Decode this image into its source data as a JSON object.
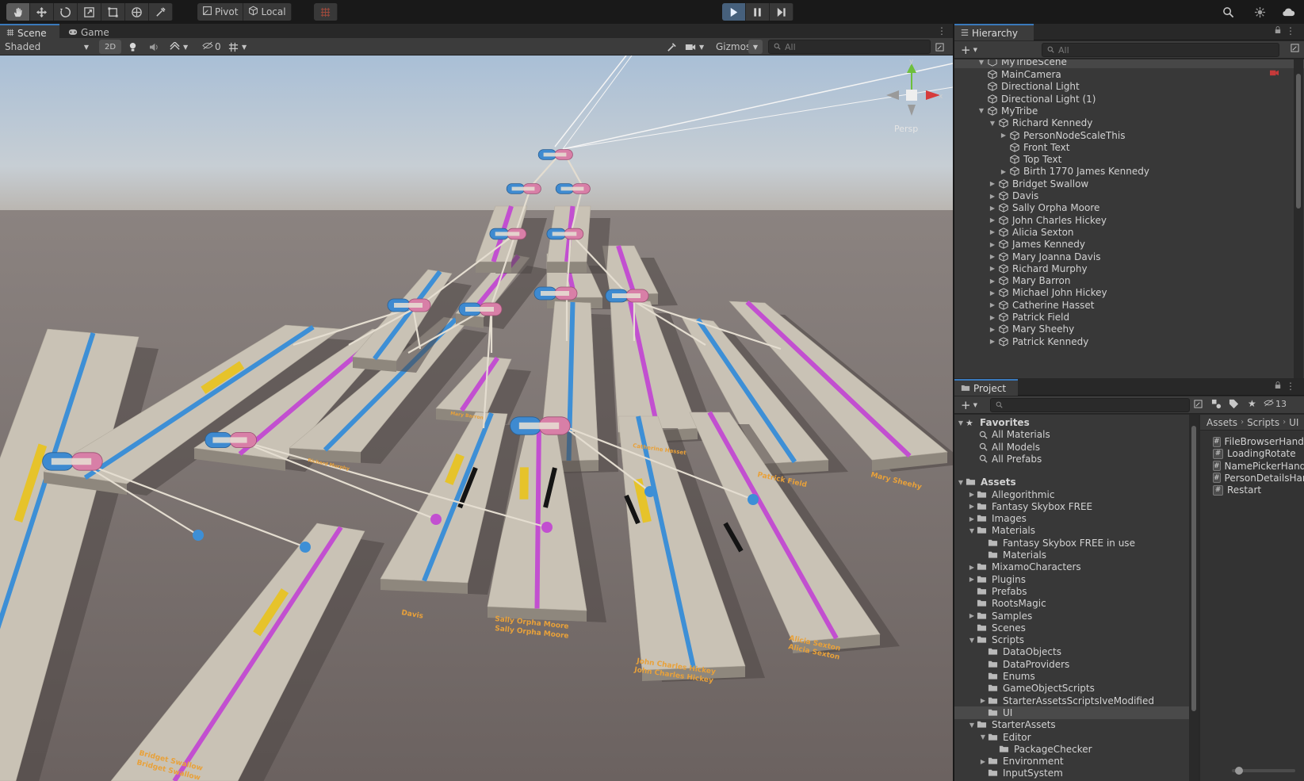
{
  "toolbar": {
    "tools": [
      "hand-tool-icon",
      "move-tool-icon",
      "rotate-tool-icon",
      "scale-tool-icon",
      "rect-tool-icon",
      "transform-tool-icon",
      "custom-tool-icon"
    ],
    "pivot_label": "Pivot",
    "local_label": "Local"
  },
  "scene_view": {
    "tabs": [
      {
        "label": "Scene"
      },
      {
        "label": "Game"
      }
    ],
    "shading_mode": "Shaded",
    "mode_2d": "2D",
    "hidden_count": "0",
    "gizmos_label": "Gizmos",
    "search_placeholder": "All",
    "projection_label": "Persp",
    "gizmo_axis_y": "y",
    "gizmo_axis_x": "x",
    "nodes": [
      {
        "label": "Bridget Swallow",
        "mirrored_label": "Bridget Swallow"
      },
      {
        "label": "Davis",
        "mirrored_label": "Davis"
      },
      {
        "label": "Sally Orpha Moore",
        "mirrored_label": "Sally Orpha Moore"
      },
      {
        "label": "John Charles Hickey",
        "mirrored_label": "John Charles Hickey"
      },
      {
        "label": "Alicia Sexton",
        "mirrored_label": "Alicia Sexton"
      },
      {
        "label": "Patrick Field"
      },
      {
        "label": "Mary Sheehy"
      },
      {
        "label": "Catherine Hasset"
      },
      {
        "label": "Mary Barron"
      },
      {
        "label": "Richard Murphy"
      },
      {
        "label": "Michael John Hickey"
      },
      {
        "label": "Mary Joanna Davis"
      },
      {
        "label": "James Kennedy"
      }
    ]
  },
  "hierarchy": {
    "tab_label": "Hierarchy",
    "search_placeholder": "All",
    "scene_name": "MyTribeScene",
    "rows": [
      {
        "label": "MainCamera",
        "indent": 1,
        "arrow": ""
      },
      {
        "label": "Directional Light",
        "indent": 1,
        "arrow": ""
      },
      {
        "label": "Directional Light (1)",
        "indent": 1,
        "arrow": ""
      },
      {
        "label": "MyTribe",
        "indent": 1,
        "arrow": "▼"
      },
      {
        "label": "Richard Kennedy",
        "indent": 2,
        "arrow": "▼"
      },
      {
        "label": "PersonNodeScaleThis",
        "indent": 3,
        "arrow": "▶"
      },
      {
        "label": "Front Text",
        "indent": 3,
        "arrow": ""
      },
      {
        "label": "Top Text",
        "indent": 3,
        "arrow": ""
      },
      {
        "label": "Birth 1770 James Kennedy",
        "indent": 3,
        "arrow": "▶"
      },
      {
        "label": "Bridget Swallow",
        "indent": 2,
        "arrow": "▶"
      },
      {
        "label": "Davis",
        "indent": 2,
        "arrow": "▶"
      },
      {
        "label": "Sally Orpha Moore",
        "indent": 2,
        "arrow": "▶"
      },
      {
        "label": "John Charles Hickey",
        "indent": 2,
        "arrow": "▶"
      },
      {
        "label": "Alicia Sexton",
        "indent": 2,
        "arrow": "▶"
      },
      {
        "label": "James Kennedy",
        "indent": 2,
        "arrow": "▶"
      },
      {
        "label": "Mary Joanna Davis",
        "indent": 2,
        "arrow": "▶"
      },
      {
        "label": "Richard Murphy",
        "indent": 2,
        "arrow": "▶"
      },
      {
        "label": "Mary Barron",
        "indent": 2,
        "arrow": "▶"
      },
      {
        "label": "Michael John Hickey",
        "indent": 2,
        "arrow": "▶"
      },
      {
        "label": "Catherine Hasset",
        "indent": 2,
        "arrow": "▶"
      },
      {
        "label": "Patrick Field",
        "indent": 2,
        "arrow": "▶"
      },
      {
        "label": "Mary Sheehy",
        "indent": 2,
        "arrow": "▶"
      },
      {
        "label": "Patrick Kennedy",
        "indent": 2,
        "arrow": "▶"
      }
    ]
  },
  "project": {
    "tab_label": "Project",
    "hidden_count": "13",
    "favorites_label": "Favorites",
    "favorites": [
      "All Materials",
      "All Models",
      "All Prefabs"
    ],
    "assets_label": "Assets",
    "folders": [
      {
        "label": "Allegorithmic",
        "indent": 1,
        "arrow": "▶"
      },
      {
        "label": "Fantasy Skybox FREE",
        "indent": 1,
        "arrow": "▶"
      },
      {
        "label": "Images",
        "indent": 1,
        "arrow": "▶"
      },
      {
        "label": "Materials",
        "indent": 1,
        "arrow": "▼"
      },
      {
        "label": "Fantasy Skybox FREE in use",
        "indent": 2,
        "arrow": ""
      },
      {
        "label": "Materials",
        "indent": 2,
        "arrow": ""
      },
      {
        "label": "MixamoCharacters",
        "indent": 1,
        "arrow": "▶"
      },
      {
        "label": "Plugins",
        "indent": 1,
        "arrow": "▶"
      },
      {
        "label": "Prefabs",
        "indent": 1,
        "arrow": ""
      },
      {
        "label": "RootsMagic",
        "indent": 1,
        "arrow": ""
      },
      {
        "label": "Samples",
        "indent": 1,
        "arrow": "▶"
      },
      {
        "label": "Scenes",
        "indent": 1,
        "arrow": ""
      },
      {
        "label": "Scripts",
        "indent": 1,
        "arrow": "▼"
      },
      {
        "label": "DataObjects",
        "indent": 2,
        "arrow": ""
      },
      {
        "label": "DataProviders",
        "indent": 2,
        "arrow": ""
      },
      {
        "label": "Enums",
        "indent": 2,
        "arrow": ""
      },
      {
        "label": "GameObjectScripts",
        "indent": 2,
        "arrow": ""
      },
      {
        "label": "StarterAssetsScriptsIveModified",
        "indent": 2,
        "arrow": "▶"
      },
      {
        "label": "UI",
        "indent": 2,
        "arrow": "",
        "selected": true
      },
      {
        "label": "StarterAssets",
        "indent": 1,
        "arrow": "▼"
      },
      {
        "label": "Editor",
        "indent": 2,
        "arrow": "▼"
      },
      {
        "label": "PackageChecker",
        "indent": 3,
        "arrow": ""
      },
      {
        "label": "Environment",
        "indent": 2,
        "arrow": "▶"
      },
      {
        "label": "InputSystem",
        "indent": 2,
        "arrow": ""
      },
      {
        "label": "Mobile",
        "indent": 2,
        "arrow": "▶"
      }
    ],
    "breadcrumb": [
      "Assets",
      "Scripts",
      "UI"
    ],
    "files": [
      "FileBrowserHandler",
      "LoadingRotate",
      "NamePickerHandler",
      "PersonDetailsHandler",
      "Restart"
    ]
  },
  "colors": {
    "accent_blue": "#3a79bb",
    "line_blue": "#3d8fd6",
    "line_magenta": "#c24fd0",
    "line_yellow": "#e6c32a",
    "platform": "#c9c2b5",
    "ground": "#6e6562"
  }
}
